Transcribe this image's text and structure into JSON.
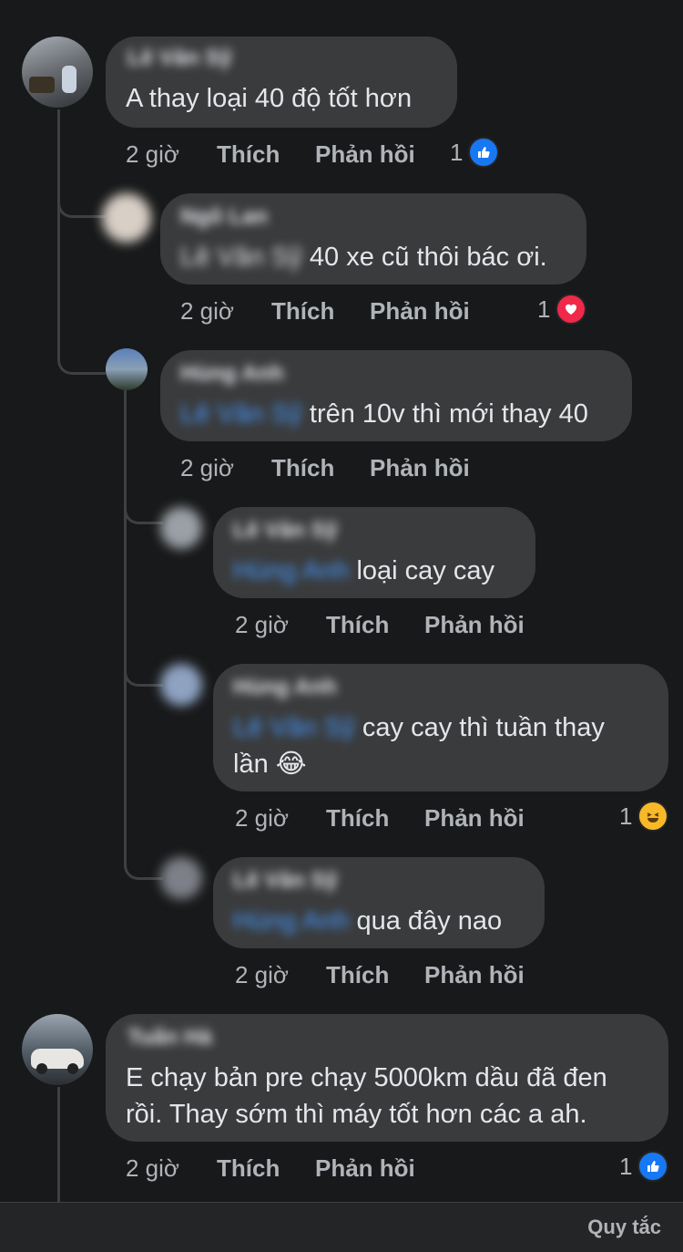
{
  "comments": [
    {
      "author": "Lê Văn Sỹ",
      "text": "A thay loại 40 độ tốt hơn",
      "time": "2 giờ",
      "like": "Thích",
      "reply": "Phản hồi",
      "reaction_count": "1",
      "reaction": "like"
    },
    {
      "author": "Ngô Lan",
      "mention": "Lê Văn Sỹ",
      "text": "40 xe cũ thôi bác ơi.",
      "time": "2 giờ",
      "like": "Thích",
      "reply": "Phản hồi",
      "reaction_count": "1",
      "reaction": "love"
    },
    {
      "author": "Hùng Anh",
      "mention": "Lê Văn Sỹ",
      "text": "trên 10v thì mới thay 40",
      "time": "2 giờ",
      "like": "Thích",
      "reply": "Phản hồi"
    },
    {
      "author": "Lê Văn Sỹ",
      "mention": "Hùng Anh",
      "text": "loại cay cay",
      "time": "2 giờ",
      "like": "Thích",
      "reply": "Phản hồi"
    },
    {
      "author": "Hùng Anh",
      "mention": "Lê Văn Sỹ",
      "text": "cay cay thì tuần thay",
      "text2": "lần 😂",
      "time": "2 giờ",
      "like": "Thích",
      "reply": "Phản hồi",
      "reaction_count": "1",
      "reaction": "haha"
    },
    {
      "author": "Lê Văn Sỹ",
      "mention": "Hùng Anh",
      "text": "qua đây nao",
      "time": "2 giờ",
      "like": "Thích",
      "reply": "Phản hồi"
    },
    {
      "author": "Tuấn Hà",
      "text": "E chạy bản pre chạy 5000km dầu đã đen",
      "text2": "rồi. Thay sớm thì máy tốt hơn các a ah.",
      "time": "2 giờ",
      "like": "Thích",
      "reply": "Phản hồi",
      "reaction_count": "1",
      "reaction": "like"
    }
  ],
  "footer": {
    "rules_label": "Quy tắc"
  },
  "colors": {
    "background": "#18191a",
    "bubble": "#3a3b3c",
    "mention": "#4599ff",
    "like": "#1877f2",
    "love": "#f02849",
    "haha": "#f7b928"
  }
}
